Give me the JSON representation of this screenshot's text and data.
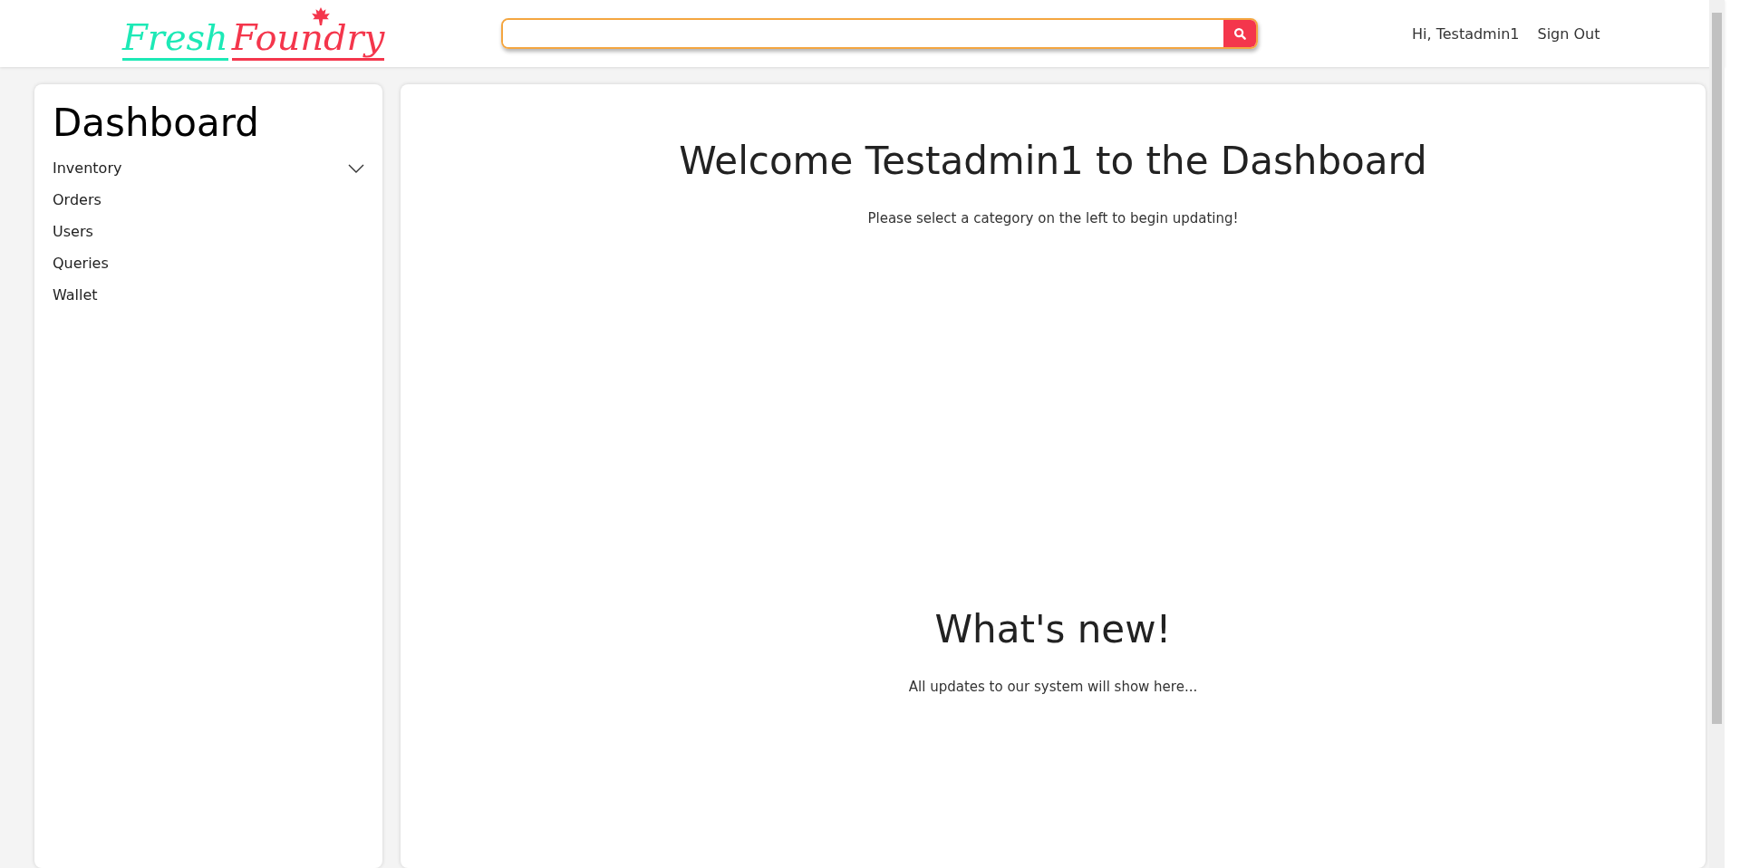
{
  "header": {
    "logo": {
      "first": "Fresh",
      "second": "Foundry"
    },
    "greeting": "Hi, Testadmin1",
    "sign_out": "Sign Out"
  },
  "sidebar": {
    "title": "Dashboard",
    "items": [
      {
        "label": "Inventory",
        "kind": "group",
        "expanded": false
      },
      {
        "label": "Orders",
        "kind": "link"
      },
      {
        "label": "Users",
        "kind": "link"
      },
      {
        "label": "Queries",
        "kind": "link"
      },
      {
        "label": "Wallet",
        "kind": "link"
      }
    ]
  },
  "main": {
    "sections": [
      {
        "heading": "Welcome Testadmin1 to the Dashboard",
        "text": "Please select a category on the left to begin updating!"
      },
      {
        "heading": "What's new!",
        "text": "All updates to our system will show here..."
      }
    ]
  }
}
